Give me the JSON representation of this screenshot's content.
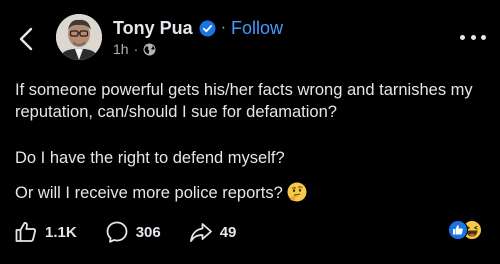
{
  "post": {
    "author": {
      "name": "Tony Pua",
      "verified": true,
      "follow_label": "Follow"
    },
    "meta": {
      "time": "1h",
      "separator": "·",
      "audience_icon": "globe-icon"
    },
    "separator_dot": "·",
    "body": {
      "p1": "If someone powerful gets his/her facts wrong and tarnishes my reputation, can/should I sue for defamation?",
      "p2": "Do I have the right to defend myself?",
      "p3": "Or will I receive more police reports?",
      "p3_emoji": "thinking-face-emoji"
    },
    "stats": {
      "likes": "1.1K",
      "comments": "306",
      "shares": "49"
    },
    "reaction_icons": [
      "like-reaction-icon",
      "haha-reaction-icon"
    ]
  },
  "colors": {
    "background": "#000000",
    "text": "#e4e6eb",
    "secondary_text": "#b0b3b8",
    "link_blue": "#4599ff",
    "verified_blue": "#1b74e4"
  }
}
